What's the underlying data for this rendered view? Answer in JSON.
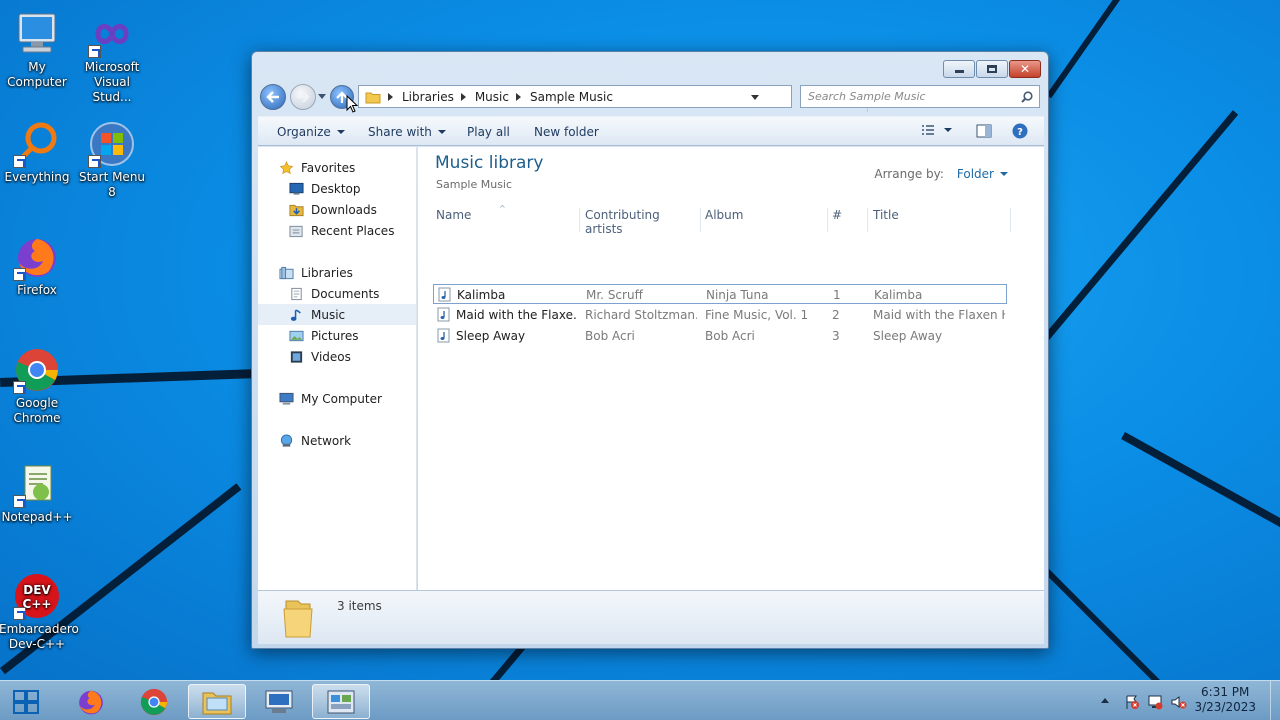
{
  "desktop": {
    "icons": [
      {
        "label": "My\nComputer",
        "icon": "computer-icon"
      },
      {
        "label": "Microsoft\nVisual Stud...",
        "icon": "visual-studio-icon"
      },
      {
        "label": "Everything",
        "icon": "everything-search-icon"
      },
      {
        "label": "Start Menu 8",
        "icon": "windows-logo-icon"
      },
      {
        "label": "Firefox",
        "icon": "firefox-icon"
      },
      {
        "label": "Google\nChrome",
        "icon": "chrome-icon"
      },
      {
        "label": "Notepad++",
        "icon": "notepad-plus-plus-icon"
      },
      {
        "label": "Embarcadero\nDev-C++",
        "icon": "dev-cpp-icon"
      }
    ]
  },
  "window": {
    "breadcrumb": [
      "Libraries",
      "Music",
      "Sample Music"
    ],
    "search_placeholder": "Search Sample Music",
    "toolbar": {
      "organize": "Organize",
      "share_with": "Share with",
      "play_all": "Play all",
      "new_folder": "New folder"
    },
    "nav": {
      "favorites": "Favorites",
      "desktop": "Desktop",
      "downloads": "Downloads",
      "recent_places": "Recent Places",
      "libraries": "Libraries",
      "documents": "Documents",
      "music": "Music",
      "pictures": "Pictures",
      "videos": "Videos",
      "my_computer": "My Computer",
      "network": "Network"
    },
    "content": {
      "title": "Music library",
      "subtitle": "Sample Music",
      "arrange_label": "Arrange by:",
      "arrange_value": "Folder",
      "columns": [
        "Name",
        "Contributing artists",
        "Album",
        "#",
        "Title"
      ],
      "rows": [
        {
          "name": "Kalimba",
          "artist": "Mr. Scruff",
          "album": "Ninja Tuna",
          "num": "1",
          "title": "Kalimba"
        },
        {
          "name": "Maid with the Flaxe...",
          "artist": "Richard Stoltzman...",
          "album": "Fine Music, Vol. 1",
          "num": "2",
          "title": "Maid with the Flaxen H..."
        },
        {
          "name": "Sleep Away",
          "artist": "Bob Acri",
          "album": "Bob Acri",
          "num": "3",
          "title": "Sleep Away"
        }
      ]
    },
    "details": {
      "count": "3 items"
    }
  },
  "taskbar": {
    "apps": [
      "firefox-icon",
      "chrome-icon",
      "file-explorer-icon",
      "remote-desktop-icon",
      "control-panel-icon"
    ],
    "time": "6:31 PM",
    "date": "3/23/2023"
  }
}
